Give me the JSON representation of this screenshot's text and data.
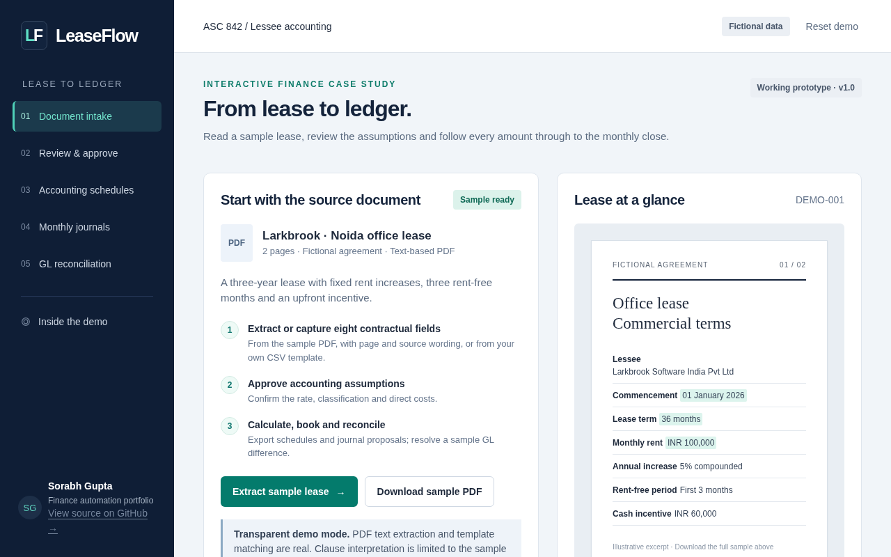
{
  "sidebar": {
    "logo": {
      "mark": [
        "L",
        "F"
      ],
      "name": "LeaseFlow"
    },
    "section_label": "LEASE TO LEDGER",
    "nav": [
      {
        "number": "01",
        "label": "Document intake",
        "selected": true
      },
      {
        "number": "02",
        "label": "Review & approve",
        "selected": false
      },
      {
        "number": "03",
        "label": "Accounting schedules",
        "selected": false
      },
      {
        "number": "04",
        "label": "Monthly journals",
        "selected": false
      },
      {
        "number": "05",
        "label": "GL reconciliation",
        "selected": false
      }
    ],
    "extra_link": {
      "label": "Inside the demo"
    },
    "profile": {
      "initials": "SG",
      "name": "Sorabh Gupta",
      "role": "Finance automation portfolio",
      "link": "View source on GitHub →"
    }
  },
  "header": {
    "breadcrumb": "ASC 842 / Lessee accounting",
    "badge": "Fictional data",
    "action": "Reset demo"
  },
  "hero": {
    "eyebrow": "INTERACTIVE FINANCE CASE STUDY",
    "title": "From lease to ledger.",
    "subtitle": "Read a sample lease, review the assumptions and follow every amount through to the monthly close.",
    "badge": "Working prototype · v1.0"
  },
  "source_card": {
    "title": "Start with the source document",
    "badge": "Sample ready",
    "file": {
      "type": "PDF",
      "name": "Larkbrook · Noida office lease",
      "meta": "2 pages · Fictional agreement · Text-based PDF"
    },
    "description": "A three-year lease with fixed rent increases, three rent-free months and an upfront incentive.",
    "steps": [
      {
        "number": "1",
        "title": "Extract or capture eight contractual fields",
        "description": "From the sample PDF, with page and source wording, or from your own CSV template."
      },
      {
        "number": "2",
        "title": "Approve accounting assumptions",
        "description": "Confirm the rate, classification and direct costs."
      },
      {
        "number": "3",
        "title": "Calculate, book and reconcile",
        "description": "Export schedules and journal proposals; resolve a sample GL difference."
      }
    ],
    "buttons": [
      {
        "kind": "primary",
        "label": "Extract sample lease",
        "icon": "→"
      },
      {
        "kind": "secondary",
        "label": "Download sample PDF"
      }
    ],
    "notice": "**Transparent demo mode.** PDF text extraction and template matching are real. Clause interpretation is limited to the sample"
  },
  "glance_card": {
    "title": "Lease at a glance",
    "reference": "DEMO-001",
    "document": {
      "label": "FICTIONAL AGREEMENT",
      "page": "01 / 02",
      "title_lines": [
        "Office lease",
        "Commercial terms"
      ],
      "fields": [
        {
          "kind": "stacked",
          "label": "Lessee",
          "value": "Larkbrook Software India Pvt Ltd",
          "highlighted": false
        },
        {
          "kind": "inline",
          "label": "Commencement",
          "value": "01 January 2026",
          "highlighted": true
        },
        {
          "kind": "inline",
          "label": "Lease term",
          "value": "36 months",
          "highlighted": true
        },
        {
          "kind": "inline",
          "label": "Monthly rent",
          "value": "INR 100,000",
          "highlighted": true
        },
        {
          "kind": "inline",
          "label": "Annual increase",
          "value": "5% compounded",
          "highlighted": false
        },
        {
          "kind": "inline",
          "label": "Rent-free period",
          "value": "First 3 months",
          "highlighted": false
        },
        {
          "kind": "inline",
          "label": "Cash incentive",
          "value": "INR 60,000",
          "highlighted": false
        }
      ],
      "footnote": "Illustrative excerpt · Download the full sample above"
    }
  }
}
